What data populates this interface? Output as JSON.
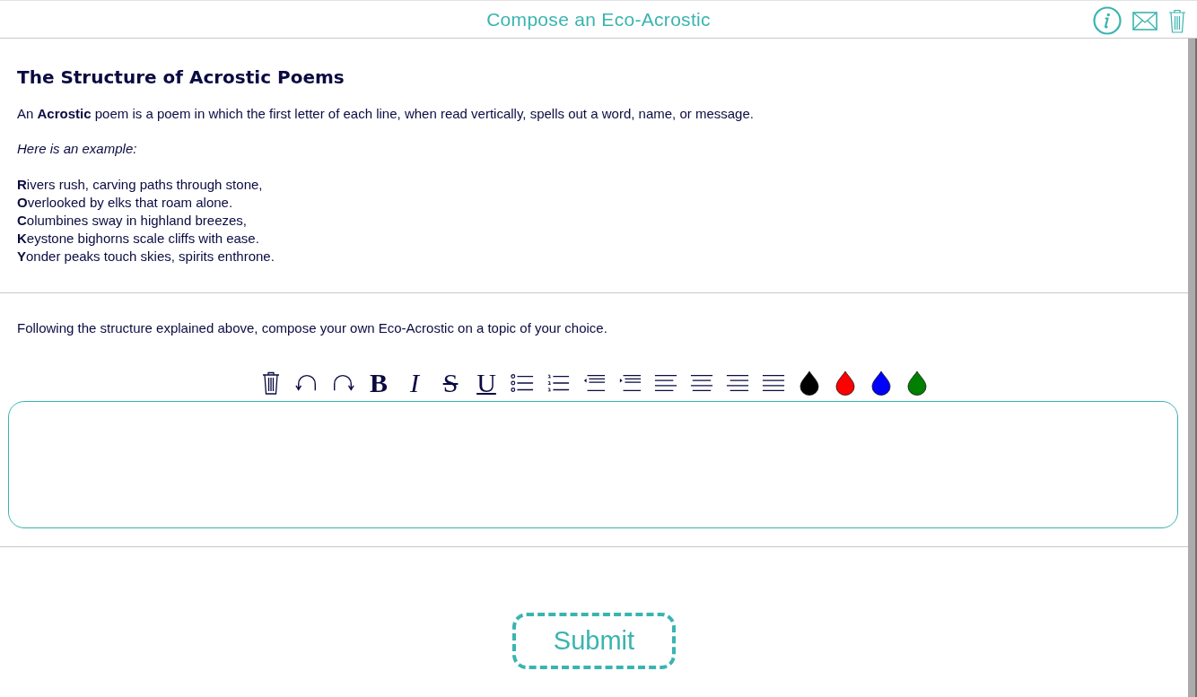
{
  "header": {
    "title": "Compose an Eco-Acrostic"
  },
  "lesson": {
    "heading": "The Structure of Acrostic Poems",
    "definition": "An **Acrostic** poem is a poem in which the first letter of each line, when read vertically, spells out a word, name, or message.",
    "example_intro": "Here is an example:",
    "poem_lines": [
      "**R**ivers rush, carving paths through stone,",
      "**O**verlooked by elks that roam alone.",
      "**C**olumbines sway in highland breezes,",
      "**K**eystone bighorns scale cliffs with ease.",
      "**Y**onder peaks touch skies, spirits enthrone."
    ]
  },
  "task": {
    "instruction": "Following the structure explained above, compose your own Eco-Acrostic on a topic of your choice."
  },
  "editor_toolbar": {
    "tools": [
      {
        "kind": "clear"
      },
      {
        "kind": "undo"
      },
      {
        "kind": "redo"
      },
      {
        "kind": "bold",
        "label": "B"
      },
      {
        "kind": "italic",
        "label": "I"
      },
      {
        "kind": "strike",
        "label": "S"
      },
      {
        "kind": "underline",
        "label": "U"
      },
      {
        "kind": "bullets"
      },
      {
        "kind": "numbering"
      },
      {
        "kind": "outdent"
      },
      {
        "kind": "indent"
      },
      {
        "kind": "left"
      },
      {
        "kind": "center"
      },
      {
        "kind": "right"
      },
      {
        "kind": "justify"
      },
      {
        "kind": "color",
        "color": "#000000"
      },
      {
        "kind": "color",
        "color": "#ff0000"
      },
      {
        "kind": "color",
        "color": "#0000ff"
      },
      {
        "kind": "color",
        "color": "#008000"
      }
    ]
  },
  "submit_button": {
    "label": "Submit"
  }
}
